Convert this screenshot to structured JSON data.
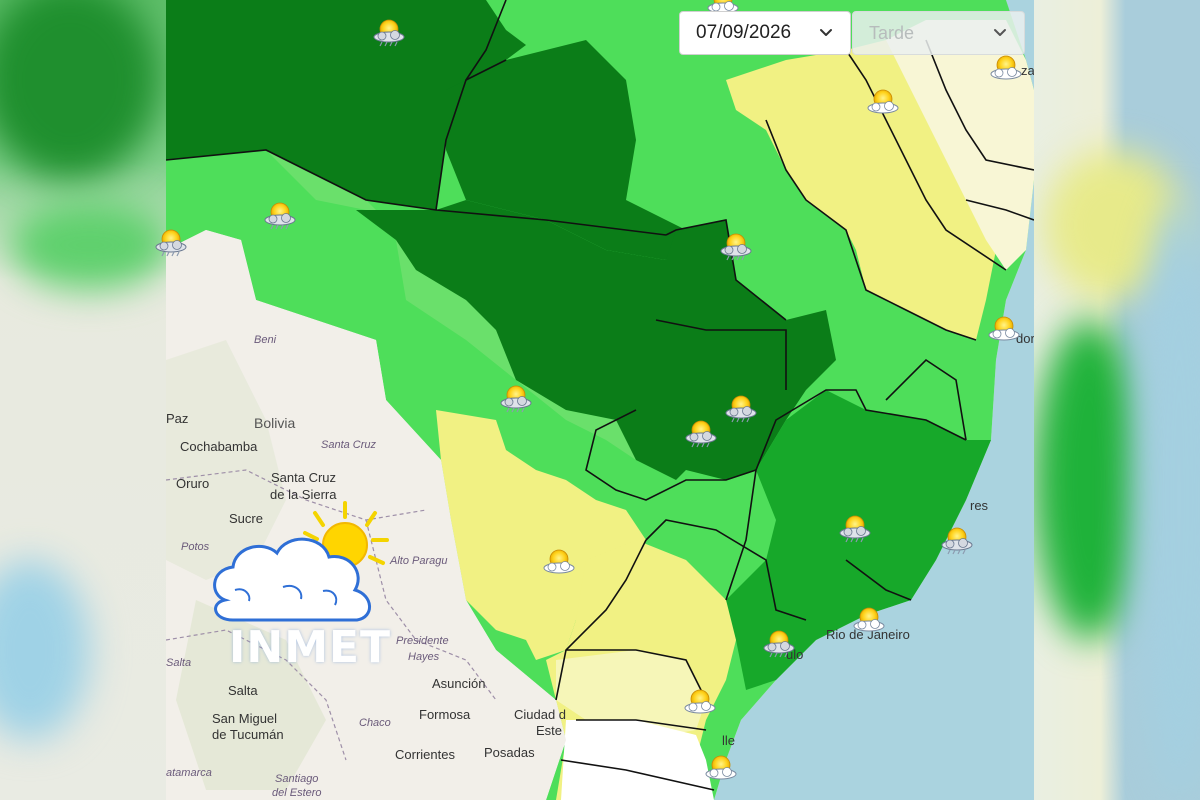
{
  "controls": {
    "date_value": "07/09/2026",
    "period_value": "Tarde"
  },
  "logo": {
    "text": "INMET"
  },
  "colors": {
    "dark_green": "#0b7d18",
    "medium_green": "#17a82a",
    "light_green": "#4ede5a",
    "pale_green": "#7be57a",
    "yellow": "#f1f183",
    "pale_yellow": "#f6f6b8",
    "cream": "#f8f6d5",
    "ocean": "#aad3df",
    "land": "#f2efe9"
  },
  "places": [
    {
      "key": "beni",
      "text": "Beni",
      "style": "italic"
    },
    {
      "key": "paz",
      "text": "Paz",
      "style": "normal"
    },
    {
      "key": "bolivia",
      "text": "Bolivia",
      "style": "country"
    },
    {
      "key": "santa_cruz_region",
      "text": "Santa Cruz",
      "style": "italic"
    },
    {
      "key": "cochabamba",
      "text": "Cochabamba",
      "style": "normal"
    },
    {
      "key": "oruro",
      "text": "Oruro",
      "style": "normal"
    },
    {
      "key": "santa_cruz_1",
      "text": "Santa Cruz",
      "style": "normal"
    },
    {
      "key": "santa_cruz_2",
      "text": "de la Sierra",
      "style": "normal"
    },
    {
      "key": "sucre",
      "text": "Sucre",
      "style": "normal"
    },
    {
      "key": "potosi",
      "text": "Potos",
      "style": "italic"
    },
    {
      "key": "alto_paraguay",
      "text": "Alto Paragu",
      "style": "italic"
    },
    {
      "key": "presidente",
      "text": "Presidente",
      "style": "italic"
    },
    {
      "key": "hayes",
      "text": "Hayes",
      "style": "italic"
    },
    {
      "key": "salta_region",
      "text": "Salta",
      "style": "italic"
    },
    {
      "key": "salta",
      "text": "Salta",
      "style": "normal"
    },
    {
      "key": "asuncion",
      "text": "Asunción",
      "style": "normal"
    },
    {
      "key": "formosa",
      "text": "Formosa",
      "style": "normal"
    },
    {
      "key": "chaco",
      "text": "Chaco",
      "style": "italic"
    },
    {
      "key": "ciudad_1",
      "text": "Ciudad d",
      "style": "normal"
    },
    {
      "key": "ciudad_2",
      "text": "Este",
      "style": "normal"
    },
    {
      "key": "san_miguel_1",
      "text": "San Miguel",
      "style": "normal"
    },
    {
      "key": "san_miguel_2",
      "text": "de Tucumán",
      "style": "normal"
    },
    {
      "key": "corrientes",
      "text": "Corrientes",
      "style": "normal"
    },
    {
      "key": "posadas",
      "text": "Posadas",
      "style": "normal"
    },
    {
      "key": "catamarca",
      "text": "atamarca",
      "style": "italic"
    },
    {
      "key": "santiago_1",
      "text": "Santiago",
      "style": "italic"
    },
    {
      "key": "santiago_2",
      "text": "del Estero",
      "style": "italic"
    },
    {
      "key": "rio",
      "text": "Rio de Janeiro",
      "style": "normal"
    },
    {
      "key": "vitoria",
      "text": "res",
      "style": "normal"
    },
    {
      "key": "salvador",
      "text": "dor",
      "style": "normal"
    },
    {
      "key": "fortaleza",
      "text": "za",
      "style": "normal"
    },
    {
      "key": "sp",
      "text": "ulo",
      "style": "normal"
    },
    {
      "key": "joinville",
      "text": "lle",
      "style": "normal"
    }
  ],
  "forecast_icons": [
    {
      "key": "ne_top",
      "icon": "partly-cloudy-icon"
    },
    {
      "key": "north_rain",
      "icon": "sun-cloud-rain-icon"
    },
    {
      "key": "fortaleza",
      "icon": "partly-cloudy-icon"
    },
    {
      "key": "ne_mid",
      "icon": "partly-cloudy-icon"
    },
    {
      "key": "acre",
      "icon": "sun-cloud-rain-icon"
    },
    {
      "key": "west_edge",
      "icon": "sun-cloud-rain-icon"
    },
    {
      "key": "tocantins",
      "icon": "sun-cloud-rain-icon"
    },
    {
      "key": "salvador",
      "icon": "partly-cloudy-icon"
    },
    {
      "key": "mato_grosso",
      "icon": "sun-cloud-rain-icon"
    },
    {
      "key": "goias_1",
      "icon": "sun-cloud-rain-icon"
    },
    {
      "key": "goias_2",
      "icon": "sun-cloud-rain-icon"
    },
    {
      "key": "minas",
      "icon": "sun-cloud-rain-icon"
    },
    {
      "key": "espirito_santo",
      "icon": "sun-cloud-rain-icon"
    },
    {
      "key": "ms",
      "icon": "partly-cloudy-icon"
    },
    {
      "key": "rio",
      "icon": "partly-cloudy-icon"
    },
    {
      "key": "sp",
      "icon": "sun-cloud-rain-icon"
    },
    {
      "key": "parana",
      "icon": "partly-cloudy-icon"
    },
    {
      "key": "sc",
      "icon": "partly-cloudy-icon"
    }
  ]
}
